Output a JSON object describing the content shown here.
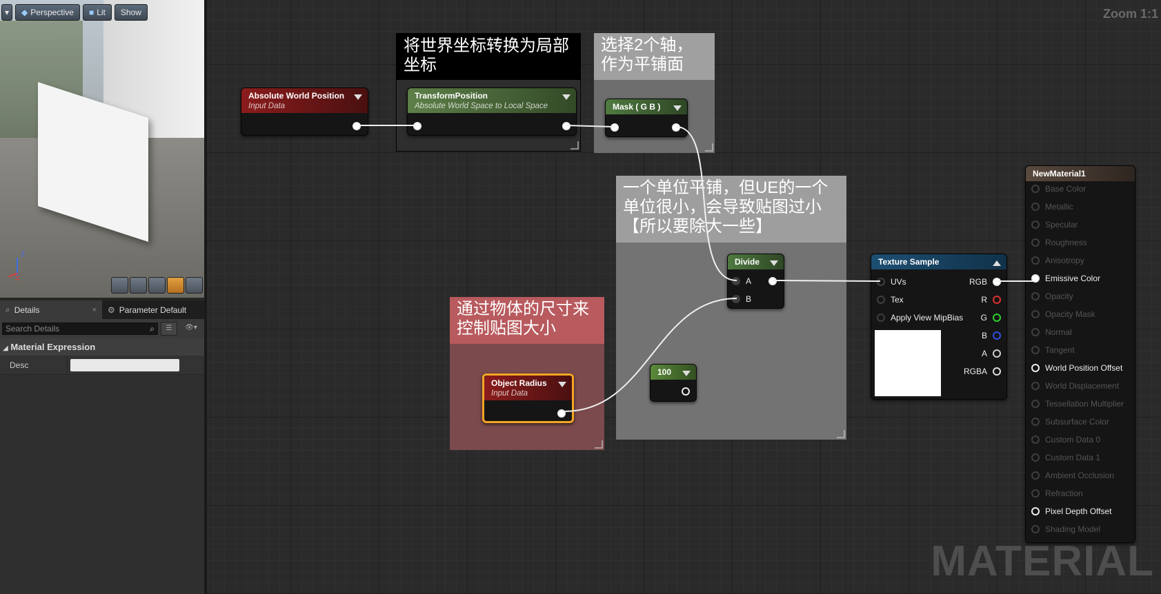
{
  "viewport": {
    "toolbar": {
      "menu_icon": "chevron-down-icon",
      "perspective": "Perspective",
      "lit": "Lit",
      "show": "Show"
    },
    "axis": {
      "z": "Z",
      "x": "X"
    }
  },
  "details": {
    "tabs": [
      {
        "label": "Details",
        "icon": "search-icon"
      },
      {
        "label": "Parameter Default",
        "icon": "gear-icon"
      }
    ],
    "search_placeholder": "Search Details",
    "section": "Material Expression",
    "props": [
      {
        "label": "Desc",
        "value": ""
      }
    ]
  },
  "graph": {
    "zoom": "Zoom 1:1",
    "watermark": "MATERIAL",
    "comments": {
      "c1": "将世界坐标转换为局部坐标",
      "c2": "选择2个轴，作为平铺面",
      "c3": "一个单位平铺，但UE的一个单位很小，会导致贴图过小【所以要除大一些】",
      "c4": "通过物体的尺寸来控制贴图大小"
    },
    "nodes": {
      "abs_world": {
        "title": "Absolute World Position",
        "sub": "Input Data",
        "color": "#8b1c1c"
      },
      "transform": {
        "title": "TransformPosition",
        "sub": "Absolute World Space to Local Space",
        "color": "#4f6e3c"
      },
      "mask": {
        "title": "Mask ( G B )",
        "color": "#3f5f35"
      },
      "divide": {
        "title": "Divide",
        "pins": [
          "A",
          "B"
        ],
        "color": "#3f5f35"
      },
      "object_radius": {
        "title": "Object Radius",
        "sub": "Input Data",
        "color": "#8b1c1c"
      },
      "const100": {
        "title": "100",
        "color": "#4a7a30"
      },
      "texture": {
        "title": "Texture Sample",
        "color": "#1d4f73",
        "inputs": [
          "UVs",
          "Tex",
          "Apply View MipBias"
        ],
        "outputs": [
          "RGB",
          "R",
          "G",
          "B",
          "A",
          "RGBA"
        ]
      },
      "result": {
        "title": "NewMaterial1",
        "pins": [
          {
            "label": "Base Color",
            "active": false
          },
          {
            "label": "Metallic",
            "active": false
          },
          {
            "label": "Specular",
            "active": false
          },
          {
            "label": "Roughness",
            "active": false
          },
          {
            "label": "Anisotropy",
            "active": false
          },
          {
            "label": "Emissive Color",
            "active": true
          },
          {
            "label": "Opacity",
            "active": false
          },
          {
            "label": "Opacity Mask",
            "active": false
          },
          {
            "label": "Normal",
            "active": false
          },
          {
            "label": "Tangent",
            "active": false
          },
          {
            "label": "World Position Offset",
            "active": true
          },
          {
            "label": "World Displacement",
            "active": false
          },
          {
            "label": "Tessellation Multiplier",
            "active": false
          },
          {
            "label": "Subsurface Color",
            "active": false
          },
          {
            "label": "Custom Data 0",
            "active": false
          },
          {
            "label": "Custom Data 1",
            "active": false
          },
          {
            "label": "Ambient Occlusion",
            "active": false
          },
          {
            "label": "Refraction",
            "active": false
          },
          {
            "label": "Pixel Depth Offset",
            "active": true
          },
          {
            "label": "Shading Model",
            "active": false
          }
        ]
      }
    }
  }
}
